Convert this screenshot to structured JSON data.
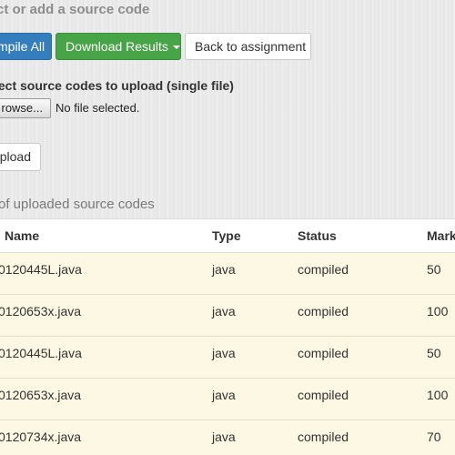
{
  "page": {
    "section_heading": "ct or add a source code"
  },
  "toolbar": {
    "compile_label": "mpile All",
    "download_label": "Download Results",
    "back_label": "Back to assignment"
  },
  "upload": {
    "label": "lect source codes to upload (single file)",
    "browse_label": "rowse...",
    "file_status": "No file selected.",
    "upload_label": "pload"
  },
  "list": {
    "title": "of uploaded source codes",
    "headers": {
      "name": "Name",
      "type": "Type",
      "status": "Status",
      "mark": "Mark"
    },
    "rows": [
      {
        "name": "0120445L.java",
        "type": "java",
        "status": "compiled",
        "mark": "50"
      },
      {
        "name": "0120653x.java",
        "type": "java",
        "status": "compiled",
        "mark": "100"
      },
      {
        "name": "0120445L.java",
        "type": "java",
        "status": "compiled",
        "mark": "50"
      },
      {
        "name": "0120653x.java",
        "type": "java",
        "status": "compiled",
        "mark": "100"
      },
      {
        "name": "0120734x.java",
        "type": "java",
        "status": "compiled",
        "mark": "70"
      }
    ]
  },
  "colors": {
    "primary": "#357ebd",
    "success": "#47a447",
    "row_highlight": "#fcf8e3"
  },
  "icons": {
    "dropdown": "caret-down-icon"
  }
}
